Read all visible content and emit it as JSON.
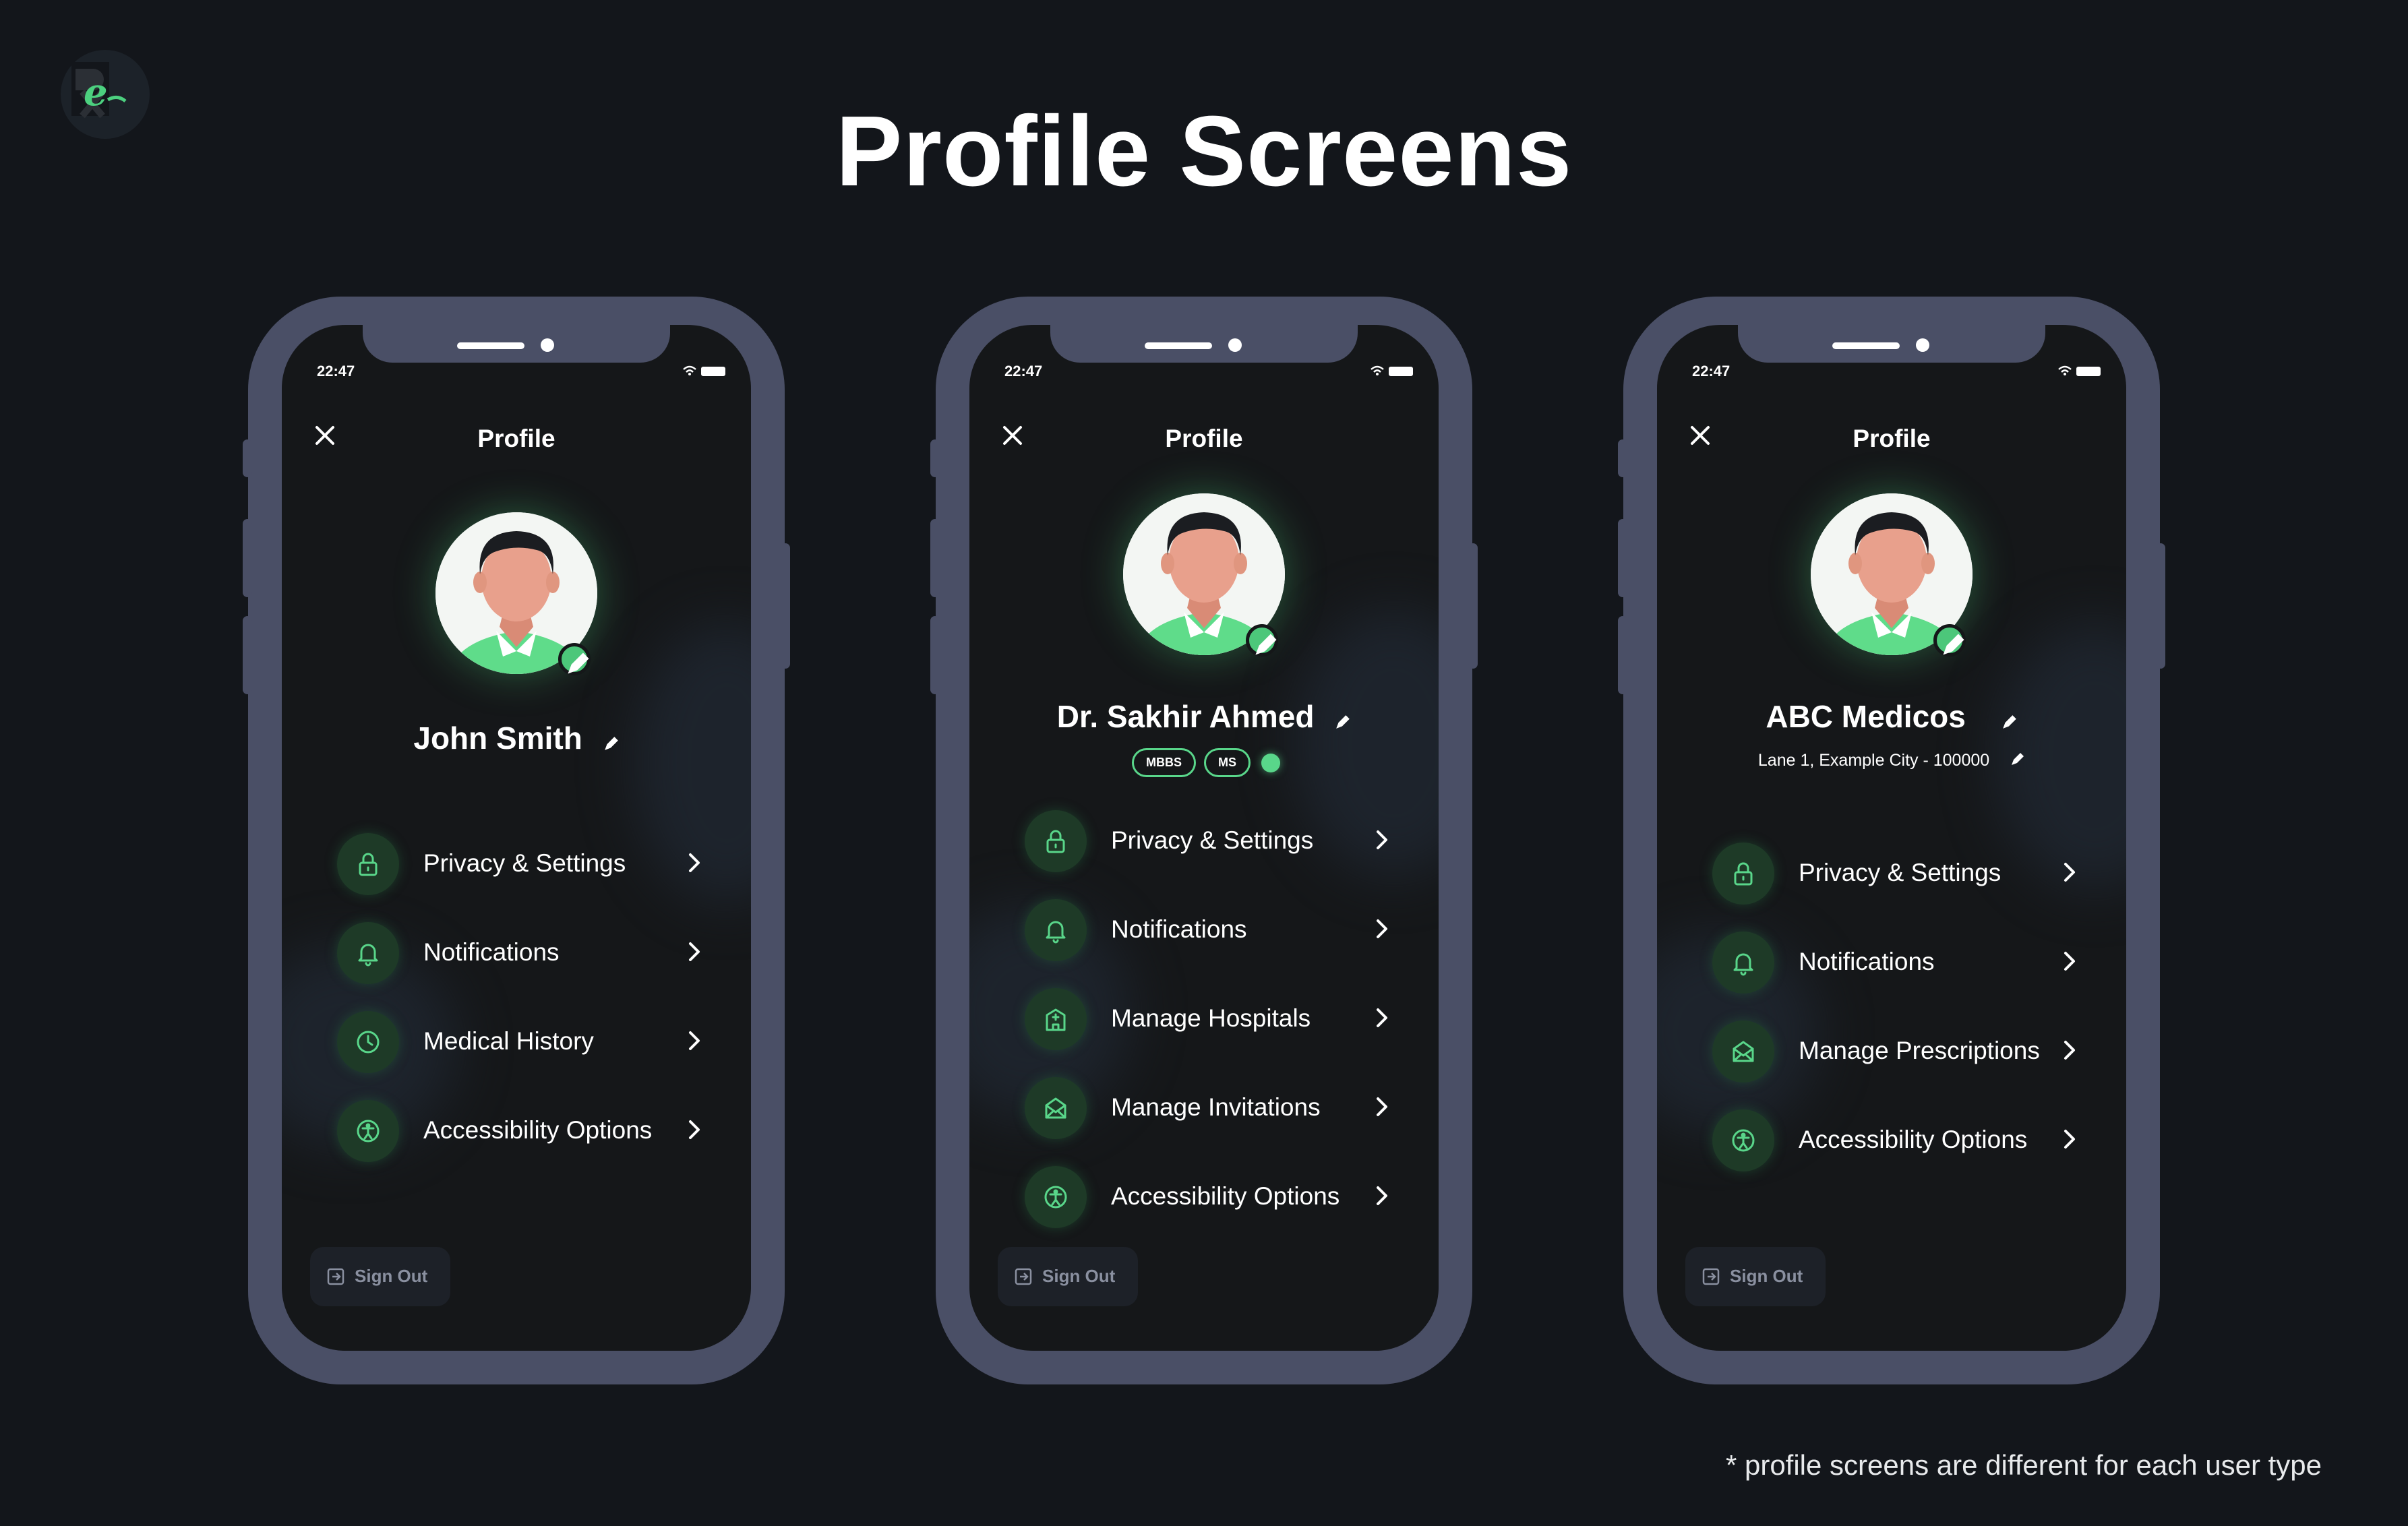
{
  "page_title": "Profile Screens",
  "footnote": "* profile screens are different for each user type",
  "colors": {
    "background": "#13161b",
    "phone_frame": "#4a4f66",
    "accent_green": "#59d68a",
    "icon_bg": "#1e3a27"
  },
  "phones": [
    {
      "time": "22:47",
      "screen_title": "Profile",
      "name": "John Smith",
      "menu": [
        {
          "label": "Privacy & Settings",
          "icon": "lock-icon"
        },
        {
          "label": "Notifications",
          "icon": "bell-icon"
        },
        {
          "label": "Medical History",
          "icon": "clock-icon"
        },
        {
          "label": "Accessibility Options",
          "icon": "accessibility-icon"
        }
      ],
      "signout": "Sign Out"
    },
    {
      "time": "22:47",
      "screen_title": "Profile",
      "name": "Dr. Sakhir Ahmed",
      "badges": [
        "MBBS",
        "MS"
      ],
      "menu": [
        {
          "label": "Privacy & Settings",
          "icon": "lock-icon"
        },
        {
          "label": "Notifications",
          "icon": "bell-icon"
        },
        {
          "label": "Manage Hospitals",
          "icon": "hospital-icon"
        },
        {
          "label": "Manage Invitations",
          "icon": "envelope-icon"
        },
        {
          "label": "Accessibility Options",
          "icon": "accessibility-icon"
        }
      ],
      "signout": "Sign Out"
    },
    {
      "time": "22:47",
      "screen_title": "Profile",
      "name": "ABC Medicos",
      "address": "Lane 1, Example City - 100000",
      "menu": [
        {
          "label": "Privacy & Settings",
          "icon": "lock-icon"
        },
        {
          "label": "Notifications",
          "icon": "bell-icon"
        },
        {
          "label": "Manage Prescriptions",
          "icon": "envelope-icon"
        },
        {
          "label": "Accessibility Options",
          "icon": "accessibility-icon"
        }
      ],
      "signout": "Sign Out"
    }
  ]
}
